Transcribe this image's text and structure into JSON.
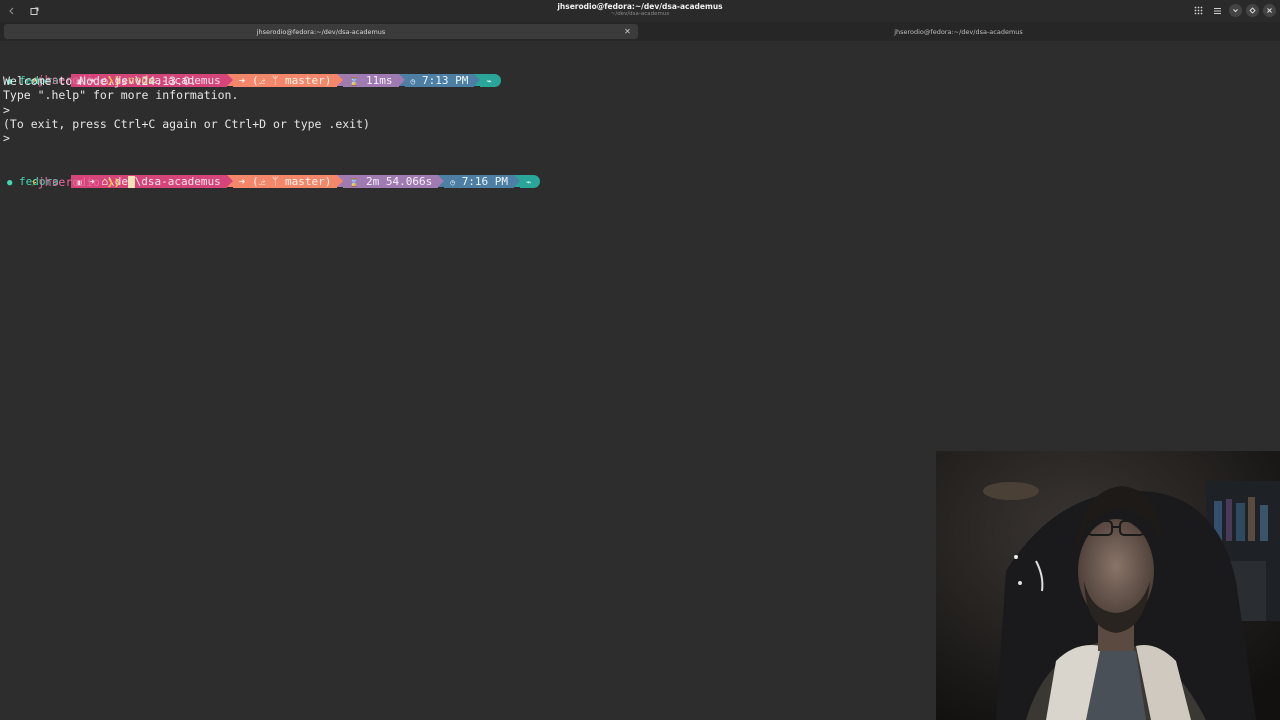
{
  "window": {
    "title": "jhserodio@fedora:~/dev/dsa-academus",
    "subtitle": "~/dev/dsa-academus",
    "icons": [
      "chevron-left-icon",
      "new-tab-icon",
      "grid-icon",
      "menu-icon",
      "minimize-icon",
      "maximize-icon",
      "close-icon"
    ]
  },
  "tabs": [
    {
      "label": "jhserodio@fedora:~/dev/dsa-academus",
      "active": true
    },
    {
      "label": "jhserodio@fedora:~/dev/dsa-academus",
      "active": false
    }
  ],
  "terminal": {
    "prompt1": {
      "os": "fedora",
      "path": "⌂\\dev\\dsa-academus",
      "git": "(⎇ ᛘ master)",
      "duration": "11ms",
      "time": "7:13 PM"
    },
    "user_line1": {
      "user": "jhserodio",
      "command": "node"
    },
    "output": [
      "Welcome to Node.js v24.13.0.",
      "Type \".help\" for more information.",
      ">",
      "(To exit, press Ctrl+C again or Ctrl+D or type .exit)",
      ">"
    ],
    "prompt2": {
      "os": "fedora",
      "path": "⌂\\dev\\dsa-academus",
      "git": "(⎇ ᛘ master)",
      "duration": "2m 54.066s",
      "time": "7:16 PM"
    },
    "user_line2": {
      "user": "jhserodio",
      "command": ""
    }
  },
  "colors": {
    "background": "#2d2d2d",
    "path_segment": "#d6457a",
    "git_segment": "#f4876a",
    "duration_segment": "#a07bb2",
    "time_segment": "#4c7fa3",
    "end_segment": "#2aa59a",
    "os_text": "#42d6b5",
    "user_text": "#e66a9b",
    "accent_yellow": "#f5c542"
  }
}
